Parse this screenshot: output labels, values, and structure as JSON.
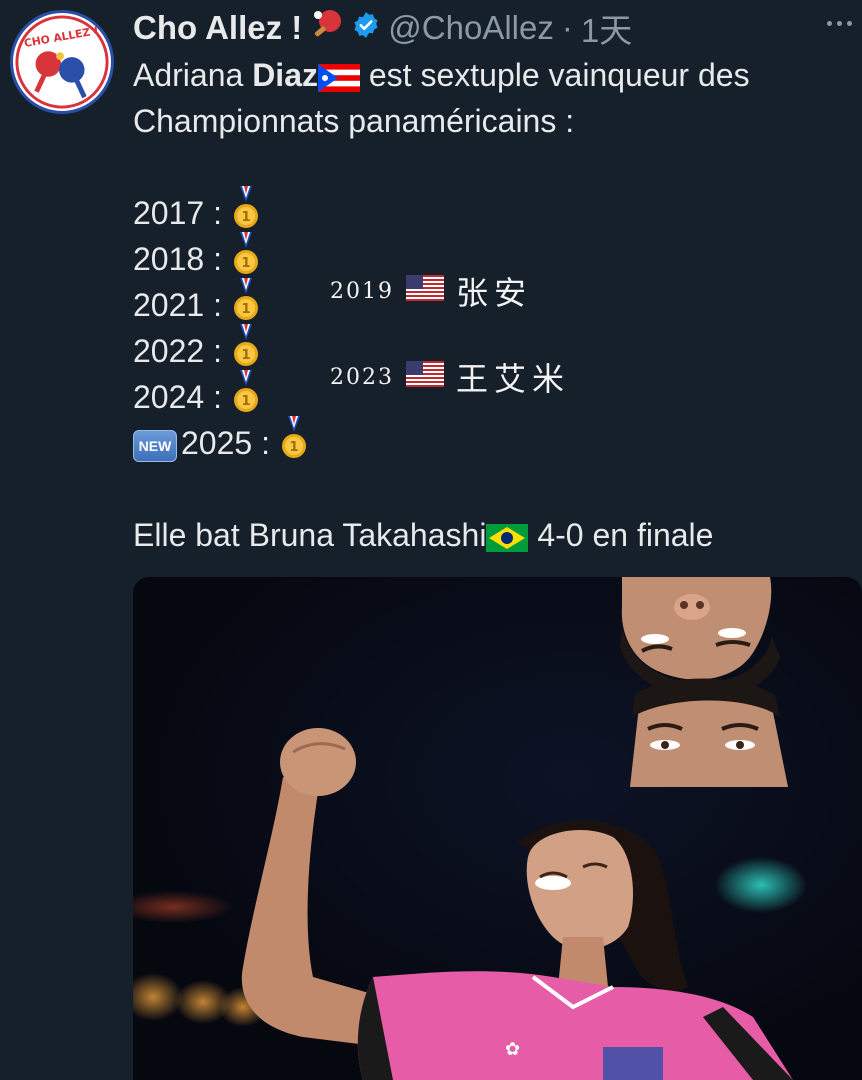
{
  "author": {
    "name": "Cho Allez !",
    "handle": "@ChoAllez",
    "separator": "·",
    "time": "1天",
    "verified": true,
    "avatar_text": "CHO ALLEZ !"
  },
  "tweet": {
    "line1_prefix": "Adriana ",
    "line1_bold": "Diaz",
    "line1_suffix": " est sextuple vainqueur des",
    "line2": "Championnats panaméricains :",
    "years": [
      "2017 :",
      "2018 :",
      "2021 :",
      "2022 :",
      "2024 :"
    ],
    "new_badge": "NEW",
    "new_year": "2025 :",
    "final_prefix": "Elle bat Bruna Takahashi",
    "final_suffix": " 4-0 en finale"
  },
  "annotations": [
    {
      "year": "2019",
      "name": "张安"
    },
    {
      "year": "2023",
      "name": "王艾米"
    }
  ],
  "icons": {
    "verified": "verified-badge-icon",
    "more": "more-dots-icon",
    "paddle": "table-tennis-paddle-icon",
    "medal": "gold-medal-icon",
    "flags": [
      "puerto-rico-flag-icon",
      "usa-flag-icon",
      "brazil-flag-icon"
    ]
  },
  "colors": {
    "background": "#15202b",
    "text": "#e7e9ea",
    "secondary": "#8b98a5",
    "verified": "#1d9bf0",
    "jersey": "#e65ca6"
  }
}
